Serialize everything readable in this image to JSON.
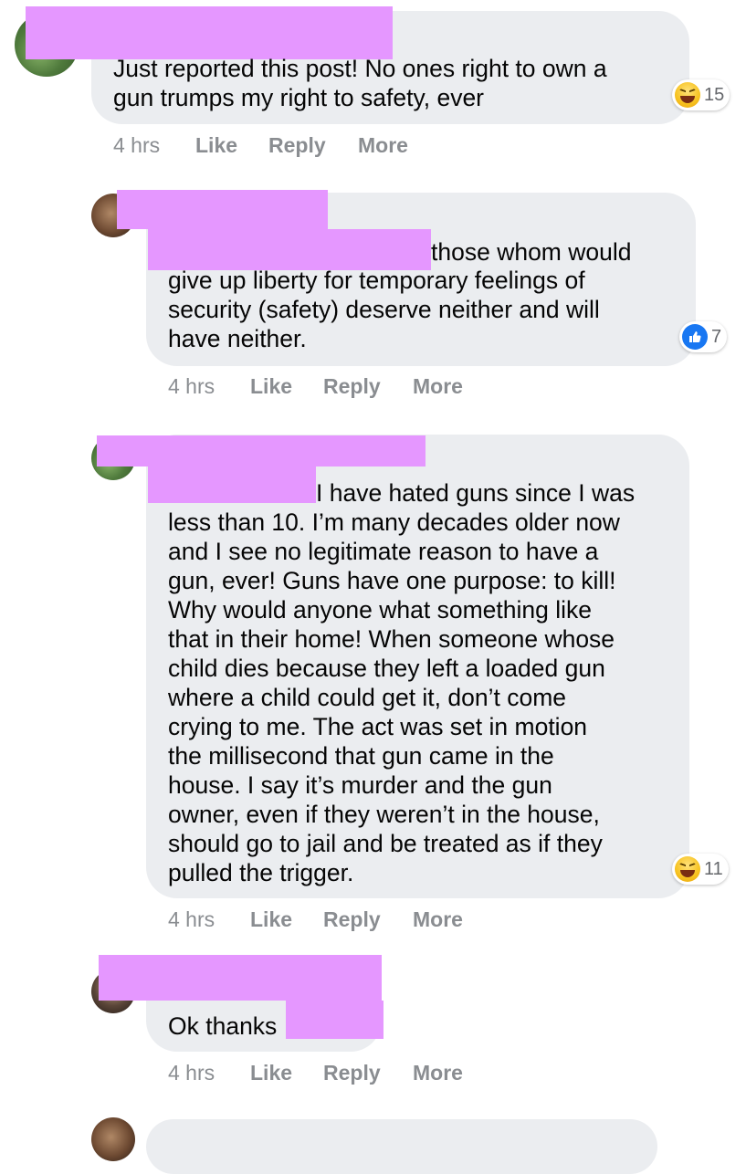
{
  "comments": [
    {
      "text_lines": [
        "Just reported this post! No ones right to own a",
        "gun trumps my right to safety, ever"
      ],
      "time": "4 hrs",
      "like": "Like",
      "reply": "Reply",
      "more": "More",
      "reaction": {
        "icon": "haha-emoji-icon",
        "count": "15"
      }
    },
    {
      "text_lines": [
        "those whom would",
        "give up liberty for temporary feelings of",
        "security (safety) deserve neither and will",
        "have neither."
      ],
      "time": "4 hrs",
      "like": "Like",
      "reply": "Reply",
      "more": "More",
      "reaction": {
        "icon": "like-thumb-icon",
        "count": "7"
      }
    },
    {
      "text_lines": [
        "I have hated guns since I was",
        "less than 10. I’m many decades older now",
        "and I see no legitimate reason to have a",
        "gun, ever! Guns have one purpose: to kill!",
        "Why would anyone what something like",
        "that in their home! When someone whose",
        "child dies because they left a loaded gun",
        "where a child could get it, don’t come",
        "crying to me. The act was set in motion",
        "the millisecond that gun came in the",
        "house. I say it’s murder and the gun",
        "owner, even if they weren’t in the house,",
        "should go to jail and be treated as if they",
        "pulled the trigger."
      ],
      "time": "4 hrs",
      "like": "Like",
      "reply": "Reply",
      "more": "More",
      "reaction": {
        "icon": "haha-emoji-icon",
        "count": "11"
      }
    },
    {
      "text_lines": [
        "Ok thanks"
      ],
      "time": "4 hrs",
      "like": "Like",
      "reply": "Reply",
      "more": "More"
    }
  ],
  "colors": {
    "bubble": "#ebedf0",
    "redaction": "#e597ff",
    "meta_text": "#8a8d91",
    "like_blue": "#1877f2"
  }
}
